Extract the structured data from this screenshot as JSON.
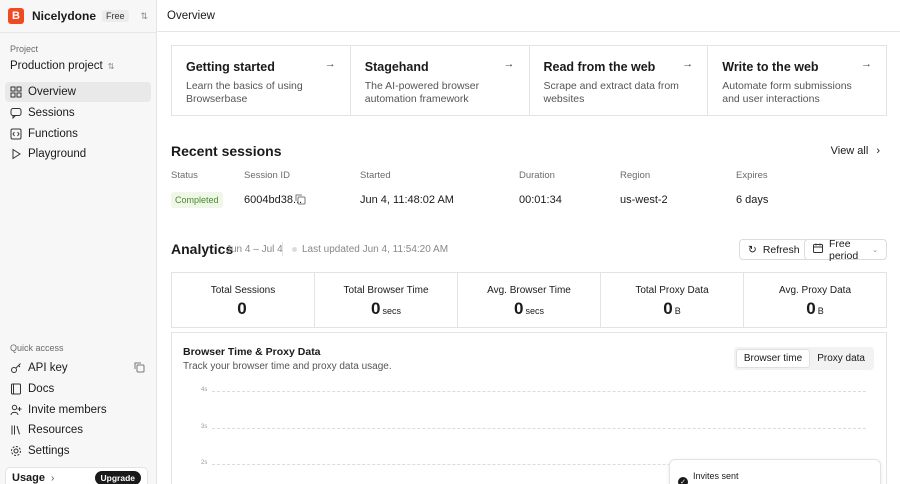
{
  "org": {
    "logo_letter": "B",
    "name": "Nicelydone",
    "plan": "Free"
  },
  "sidebar": {
    "project_label": "Project",
    "project_name": "Production project",
    "nav": [
      {
        "label": "Overview",
        "icon": "grid-icon"
      },
      {
        "label": "Sessions",
        "icon": "chat-icon"
      },
      {
        "label": "Functions",
        "icon": "code-icon"
      },
      {
        "label": "Playground",
        "icon": "play-icon"
      }
    ],
    "quick_access_label": "Quick access",
    "quick": [
      {
        "label": "API key",
        "icon": "key-icon"
      },
      {
        "label": "Docs",
        "icon": "book-icon"
      },
      {
        "label": "Invite members",
        "icon": "user-plus-icon"
      },
      {
        "label": "Resources",
        "icon": "library-icon"
      },
      {
        "label": "Settings",
        "icon": "gear-icon"
      }
    ],
    "usage_label": "Usage",
    "upgrade_label": "Upgrade"
  },
  "header": {
    "title": "Overview"
  },
  "cards": [
    {
      "title": "Getting started",
      "desc": "Learn the basics of using Browserbase"
    },
    {
      "title": "Stagehand",
      "desc": "The AI-powered browser automation framework"
    },
    {
      "title": "Read from the web",
      "desc": "Scrape and extract data from websites"
    },
    {
      "title": "Write to the web",
      "desc": "Automate form submissions and user interactions"
    }
  ],
  "recent_sessions": {
    "title": "Recent sessions",
    "view_all": "View all",
    "columns": [
      "Status",
      "Session ID",
      "Started",
      "Duration",
      "Region",
      "Expires"
    ],
    "row": {
      "status": "Completed",
      "session_id": "6004bd38...",
      "started": "Jun 4, 11:48:02 AM",
      "duration": "00:01:34",
      "region": "us-west-2",
      "expires": "6 days"
    }
  },
  "analytics": {
    "title": "Analytics",
    "range": "Jun 4 – Jul 4",
    "last_updated": "Last updated Jun 4, 11:54:20 AM",
    "refresh_label": "Refresh",
    "period_label": "Free period",
    "stats": [
      {
        "label": "Total Sessions",
        "value": "0",
        "unit": ""
      },
      {
        "label": "Total Browser Time",
        "value": "0",
        "unit": "secs"
      },
      {
        "label": "Avg. Browser Time",
        "value": "0",
        "unit": "secs"
      },
      {
        "label": "Total Proxy Data",
        "value": "0",
        "unit": "B"
      },
      {
        "label": "Avg. Proxy Data",
        "value": "0",
        "unit": "B"
      }
    ]
  },
  "chart_panel": {
    "title": "Browser Time & Proxy Data",
    "subtitle": "Track your browser time and proxy data usage.",
    "tabs": [
      "Browser time",
      "Proxy data"
    ],
    "active_tab": "Browser time",
    "y_ticks": [
      "4s",
      "3s",
      "2s"
    ]
  },
  "toast": {
    "text": "Invites sent"
  },
  "colors": {
    "brand": "#f04a23",
    "status_completed": "#4b8a2a"
  }
}
